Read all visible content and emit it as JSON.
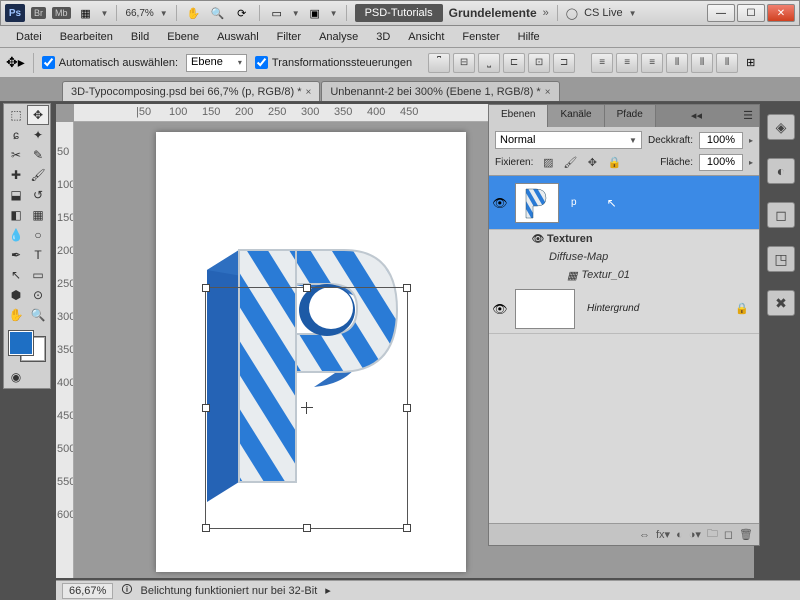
{
  "titlebar": {
    "ps_label": "Ps",
    "br_label": "Br",
    "mb_label": "Mb",
    "zoom": "66,7%",
    "psd_tutorials": "PSD-Tutorials",
    "workspace": "Grundelemente",
    "cslive": "CS Live"
  },
  "menu": [
    "Datei",
    "Bearbeiten",
    "Bild",
    "Ebene",
    "Auswahl",
    "Filter",
    "Analyse",
    "3D",
    "Ansicht",
    "Fenster",
    "Hilfe"
  ],
  "options": {
    "auto_select": "Automatisch auswählen:",
    "auto_select_value": "Ebene",
    "transform_controls": "Transformationssteuerungen"
  },
  "tabs": {
    "tab1": "3D-Typocomposing.psd bei 66,7% (p, RGB/8) *",
    "tab2": "Unbenannt-2 bei 300% (Ebene 1, RGB/8) *"
  },
  "layers_panel": {
    "tabs": [
      "Ebenen",
      "Kanäle",
      "Pfade"
    ],
    "blend_mode": "Normal",
    "opacity_label": "Deckkraft:",
    "opacity_value": "100%",
    "lock_label": "Fixieren:",
    "fill_label": "Fläche:",
    "fill_value": "100%",
    "layer_p": "p",
    "group_texturen": "Texturen",
    "diffuse_map": "Diffuse-Map",
    "textur01": "Textur_01",
    "hintergrund": "Hintergrund"
  },
  "status": {
    "zoom": "66,67%",
    "info": "Belichtung funktioniert nur bei 32-Bit"
  },
  "ruler_h": [
    "|50",
    "100",
    "150",
    "200",
    "250",
    "300",
    "350",
    "400",
    "450"
  ],
  "ruler_v": [
    "50",
    "100",
    "150",
    "200",
    "250",
    "300",
    "350",
    "400",
    "450",
    "500",
    "550",
    "600"
  ]
}
